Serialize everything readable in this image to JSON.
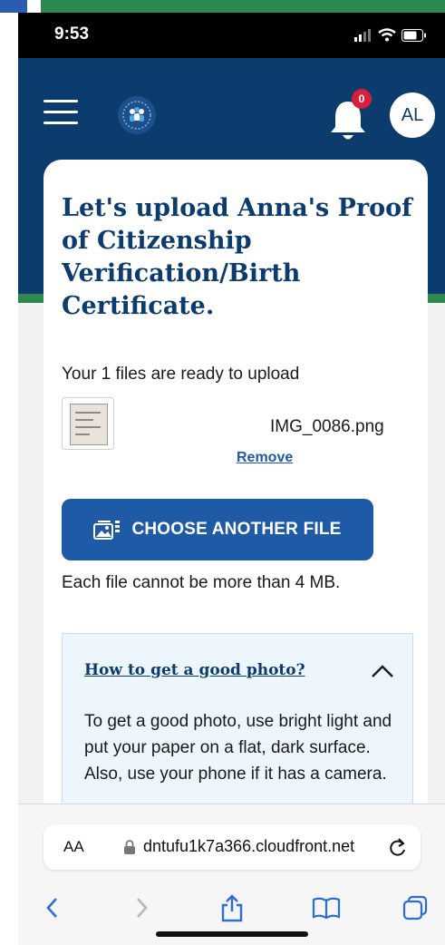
{
  "status_bar": {
    "time": "9:53"
  },
  "header": {
    "notification_count": "0",
    "avatar_initials": "AL"
  },
  "upload": {
    "title": "Let's upload Anna's Proof of Citizenship Verification/Birth Certificate.",
    "ready_text": "Your 1 files are ready to upload",
    "file_name": "IMG_0086.png",
    "remove_label": "Remove",
    "choose_label": "CHOOSE ANOTHER FILE",
    "limit_text": "Each file cannot be more than 4 MB."
  },
  "tips": {
    "title": "How to get a good photo?",
    "body": "To get a good photo, use bright light and put your paper on a flat, dark surface. Also, use your phone if it has a camera."
  },
  "browser": {
    "text_size_label": "AA",
    "url": "dntufu1k7a366.cloudfront.net"
  },
  "colors": {
    "navy": "#0c3b6e",
    "accent_blue": "#1f5aa6",
    "green": "#2d8a4e",
    "badge_red": "#d71e3b"
  }
}
